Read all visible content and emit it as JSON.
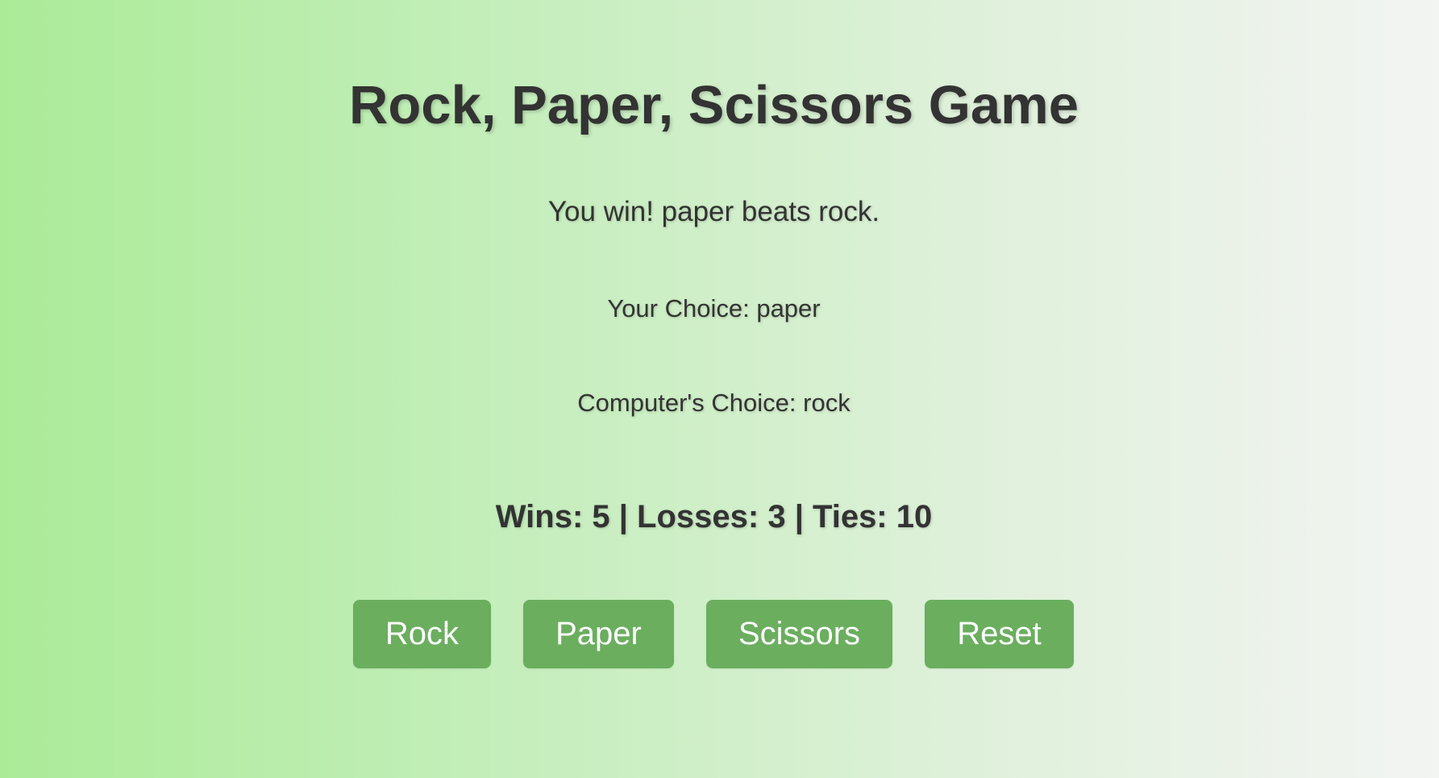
{
  "title": "Rock, Paper, Scissors Game",
  "result_message": "You win! paper beats rock.",
  "your_choice": "Your Choice: paper",
  "computer_choice": "Computer's Choice: rock",
  "score": "Wins: 5 | Losses: 3 | Ties: 10",
  "buttons": {
    "rock": "Rock",
    "paper": "Paper",
    "scissors": "Scissors",
    "reset": "Reset"
  },
  "colors": {
    "button": "#6aae5e",
    "button_text": "#ffffff",
    "text": "#333333",
    "background_start": "#abeb98",
    "background_end": "#f3f4f3"
  }
}
